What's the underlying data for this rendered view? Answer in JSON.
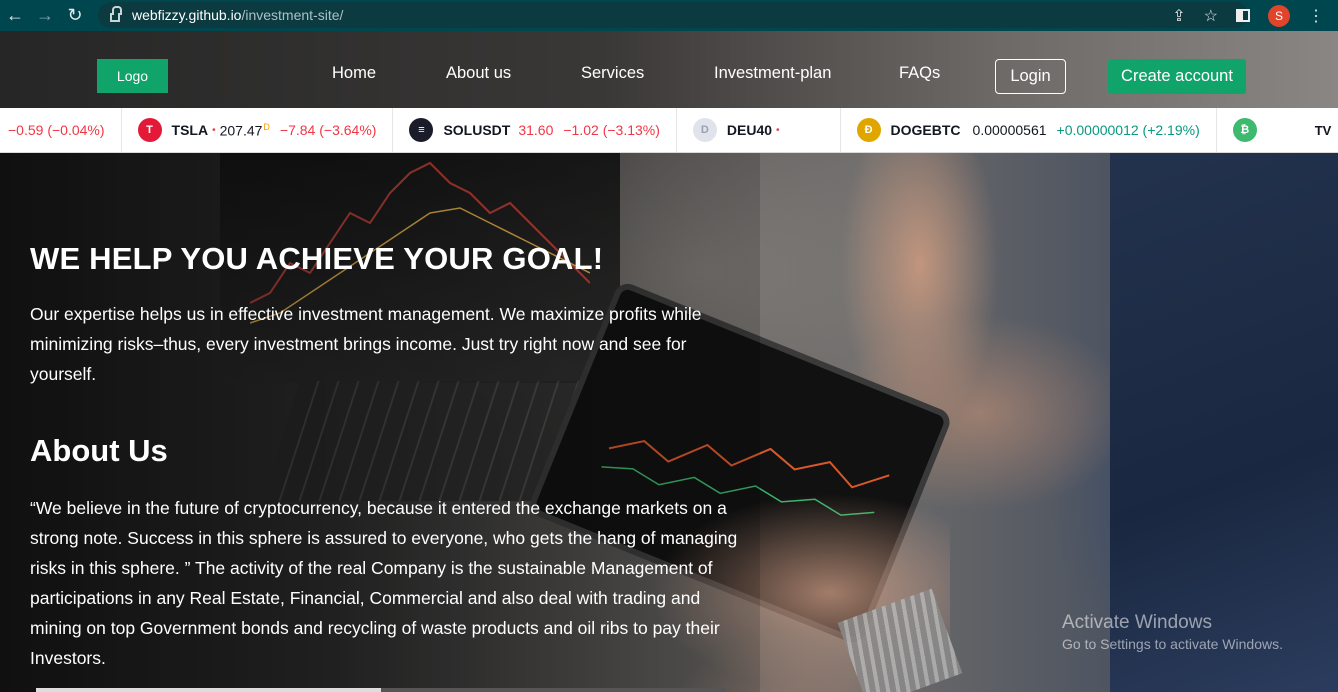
{
  "browser": {
    "url_host": "webfizzy.github.io",
    "url_path": "/investment-site/",
    "profile_initial": "S"
  },
  "header": {
    "logo": "Logo",
    "nav": [
      "Home",
      "About us",
      "Services",
      "Investment-plan",
      "FAQs"
    ],
    "login": "Login",
    "create_account": "Create account"
  },
  "ticker": {
    "items": [
      {
        "symbol": "",
        "price": "",
        "change": "−0.59 (−0.04%)",
        "dir": "down",
        "icon": ""
      },
      {
        "symbol": "TSLA",
        "price": "207.47",
        "price_sup": "D",
        "change": "−7.84 (−3.64%)",
        "dir": "down",
        "icon": "tesla-icon",
        "color": "#e31937",
        "dot": "•"
      },
      {
        "symbol": "SOLUSDT",
        "price": "31.60",
        "change": "−1.02 (−3.13%)",
        "dir": "down",
        "icon": "solana-icon",
        "color": "#1a1d29",
        "price_red": true
      },
      {
        "symbol": "DEU40",
        "price": "",
        "change": "",
        "dir": "none",
        "icon": "dax-icon",
        "color": "#e0e3eb",
        "dot": "•",
        "icon_letter": "D"
      },
      {
        "symbol": "DOGEBTC",
        "price": "0.00000561",
        "change": "+0.00000012 (+2.19%)",
        "dir": "up",
        "icon": "doge-icon",
        "color": "#e1a500",
        "icon_letter": "Ð"
      },
      {
        "symbol": "",
        "price": "",
        "change": "",
        "dir": "none",
        "icon": "bitcoin-icon",
        "color": "#3dba6f",
        "icon_letter": "₿"
      }
    ],
    "brand": "TV"
  },
  "hero": {
    "title": "WE HELP YOU ACHIEVE YOUR GOAL!",
    "text": "Our expertise helps us in effective investment management. We maximize profits while minimizing risks–thus, every investment brings income. Just try right now and see for yourself."
  },
  "about": {
    "title": "About Us",
    "text": "“We believe in the future of cryptocurrency, because it entered the exchange markets on a strong note. Success in this sphere is assured to everyone, who gets the hang of managing risks in this sphere. ” The activity of the real Company is the sustainable Management of participations in any Real Estate, Financial, Commercial and also deal with trading and mining on top Government bonds and recycling of waste products and oil ribs to pay their Investors."
  },
  "watermark": {
    "line1": "Activate Windows",
    "line2": "Go to Settings to activate Windows."
  },
  "colors": {
    "brand_green": "#10a36a",
    "chrome": "#00464f",
    "down": "#f23645",
    "up": "#089981"
  }
}
